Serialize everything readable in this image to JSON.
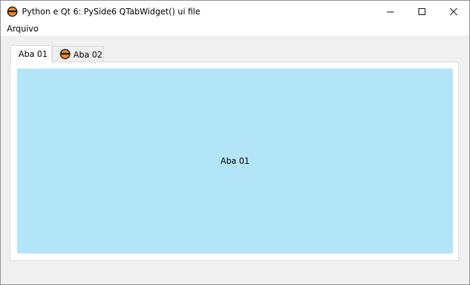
{
  "window": {
    "title": "Python e Qt 6: PySide6 QTabWidget() ui file",
    "icon": "python-app-icon",
    "controls": {
      "minimize_icon": "minimize-icon",
      "maximize_icon": "maximize-icon",
      "close_icon": "close-icon"
    }
  },
  "menubar": {
    "items": [
      {
        "label": "Arquivo"
      }
    ]
  },
  "tabs": [
    {
      "label": "Aba 01",
      "active": true,
      "icon": null
    },
    {
      "label": "Aba 02",
      "active": false,
      "icon": "python-tab-icon"
    }
  ],
  "content": {
    "label": "Aba 01",
    "background": "#b3e5f8"
  }
}
